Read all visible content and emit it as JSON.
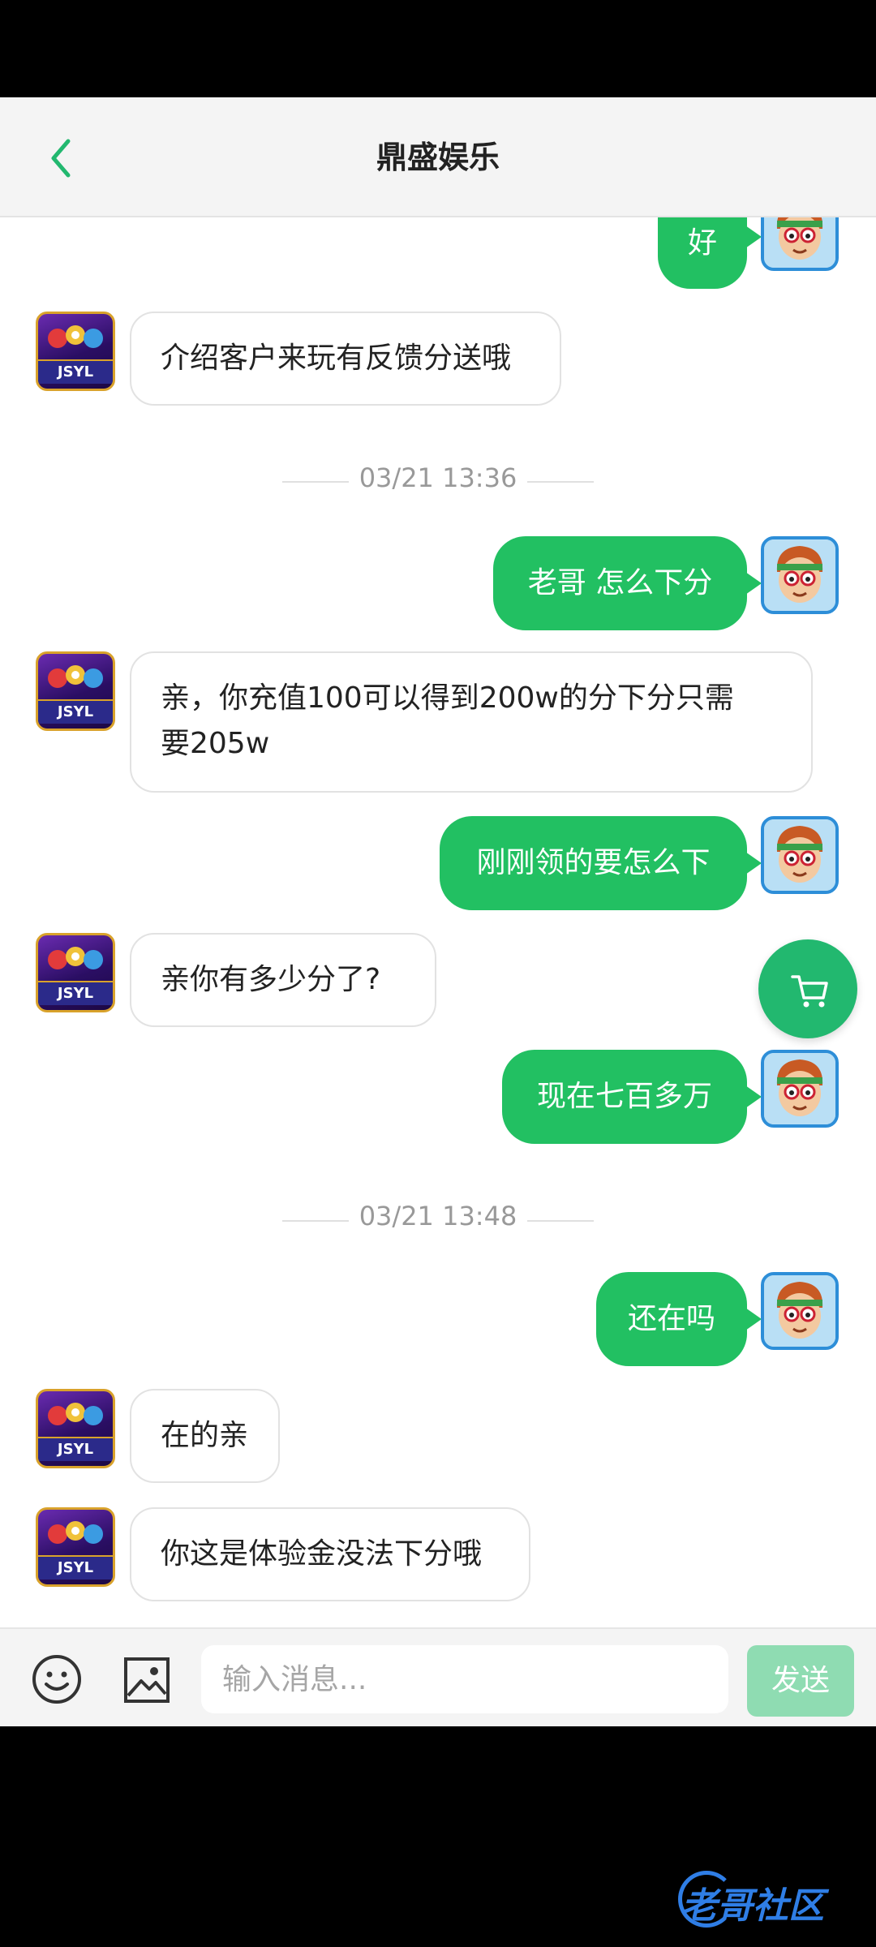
{
  "header": {
    "title": "鼎盛娱乐"
  },
  "messages": [
    {
      "side": "right",
      "text": "好"
    },
    {
      "side": "left",
      "text": "介绍客户来玩有反馈分送哦"
    },
    {
      "side": "time",
      "text": "03/21 13:36"
    },
    {
      "side": "right",
      "text": "老哥 怎么下分"
    },
    {
      "side": "left",
      "line1": "亲，你充值100可以得到200w的分下分只需",
      "line2": "要205w"
    },
    {
      "side": "right",
      "text": "刚刚领的要怎么下"
    },
    {
      "side": "left",
      "text": "亲你有多少分了?"
    },
    {
      "side": "right",
      "text": "现在七百多万"
    },
    {
      "side": "time",
      "text": "03/21 13:48"
    },
    {
      "side": "right",
      "text": "还在吗"
    },
    {
      "side": "left",
      "text": "在的亲"
    },
    {
      "side": "left",
      "text": "你这是体验金没法下分哦"
    }
  ],
  "avatar": {
    "bot_logo": "JSYL"
  },
  "input": {
    "placeholder": "输入消息...",
    "value": ""
  },
  "send_label": "发送",
  "watermark": "老哥社区",
  "colors": {
    "accent": "#22c062",
    "send_disabled": "#8fdcb2",
    "fab": "#22b86f"
  },
  "icons": {
    "back": "chevron-left-icon",
    "cart": "cart-icon",
    "emoji": "smiley-icon",
    "image": "image-icon"
  }
}
